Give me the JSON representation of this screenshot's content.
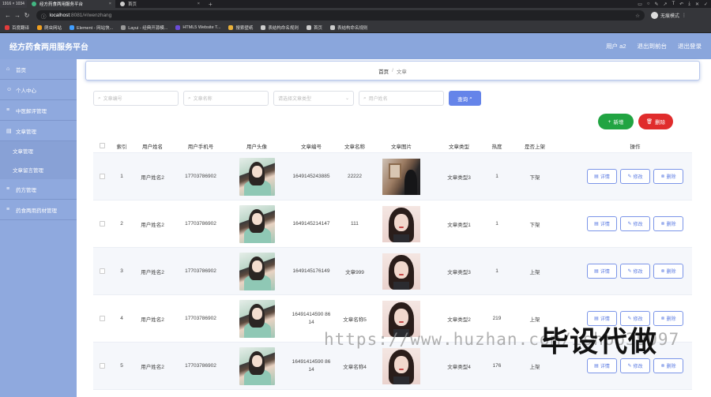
{
  "browser": {
    "resolution_badge": "1916 × 1034",
    "tabs": [
      {
        "title": "经方药食两用服务平台",
        "active": true
      },
      {
        "title": "首页",
        "active": false
      }
    ],
    "url_host": "localhost",
    "url_path": ":8081/#/wenzhang",
    "incognito_label": "无痕模式",
    "bookmarks": [
      {
        "label": "百度翻译",
        "color": "#e23c3c"
      },
      {
        "label": "爬虫网站",
        "color": "#f0a020"
      },
      {
        "label": "Element - 网站快...",
        "color": "#409eff"
      },
      {
        "label": "Layui - 经典开源模...",
        "color": "#999999"
      },
      {
        "label": "HTML5 Website T...",
        "color": "#6a4cd8"
      },
      {
        "label": "搜索壁纸",
        "color": "#e9b13a"
      },
      {
        "label": "表结构命名规则",
        "color": "#cccccc"
      },
      {
        "label": "首页",
        "color": "#cccccc"
      },
      {
        "label": "表结构命名规则",
        "color": "#cccccc"
      }
    ]
  },
  "header": {
    "title": "经方药食两用服务平台",
    "user_label": "用户 a2",
    "exit_label": "退出到前台",
    "logout_label": "退出登录"
  },
  "sidebar": {
    "items": [
      {
        "label": "首页",
        "icon": "home-icon"
      },
      {
        "label": "个人中心",
        "icon": "user-icon"
      },
      {
        "label": "中医解评管理",
        "icon": "list-icon"
      },
      {
        "label": "文章管理",
        "icon": "doc-icon"
      }
    ],
    "subitems": [
      {
        "label": "文章管理"
      },
      {
        "label": "文章留言管理"
      }
    ],
    "items_after": [
      {
        "label": "药方管理",
        "icon": "list-icon"
      },
      {
        "label": "药食两用药材管理",
        "icon": "list-icon"
      }
    ]
  },
  "breadcrumb": {
    "home": "首页",
    "separator": "/",
    "current": "文章"
  },
  "search": {
    "article_no_placeholder": "文章编号",
    "article_name_placeholder": "文章名称",
    "article_type_placeholder": "请选择文章类型",
    "user_name_placeholder": "用户姓名",
    "search_label": "查询"
  },
  "actions": {
    "add_label": "新增",
    "delete_label": "删除"
  },
  "table": {
    "headers": {
      "index": "索引",
      "user_name": "用户姓名",
      "user_phone": "用户手机号",
      "avatar": "用户头像",
      "article_no": "文章编号",
      "article_name": "文章名称",
      "article_image": "文章图片",
      "article_type": "文章类型",
      "hot": "热度",
      "on_shelf": "是否上架",
      "ops": "操作"
    },
    "op_labels": {
      "detail": "详情",
      "edit": "修改",
      "delete": "删除"
    },
    "rows": [
      {
        "index": "1",
        "user_name": "用户姓名2",
        "phone": "17703786902",
        "article_no": "1649145243885",
        "article_name": "22222",
        "image": "photo-a",
        "article_type": "文章类型3",
        "hot": "1",
        "on_shelf": "下架"
      },
      {
        "index": "2",
        "user_name": "用户姓名2",
        "phone": "17703786902",
        "article_no": "1649145214147",
        "article_name": "111",
        "image": "photo-b",
        "article_type": "文章类型1",
        "hot": "1",
        "on_shelf": "下架"
      },
      {
        "index": "3",
        "user_name": "用户姓名2",
        "phone": "17703786902",
        "article_no": "1649145176149",
        "article_name": "文章999",
        "image": "photo-b",
        "article_type": "文章类型3",
        "hot": "1",
        "on_shelf": "上架"
      },
      {
        "index": "4",
        "user_name": "用户姓名2",
        "phone": "17703786902",
        "article_no": "16491414590 8614",
        "article_name": "文章名称5",
        "image": "photo-b",
        "article_type": "文章类型2",
        "hot": "219",
        "on_shelf": "上架"
      },
      {
        "index": "5",
        "user_name": "用户姓名2",
        "phone": "17703786902",
        "article_no": "16491414590 8614",
        "article_name": "文章名称4",
        "image": "photo-b",
        "article_type": "文章类型4",
        "hot": "176",
        "on_shelf": "上架"
      }
    ]
  },
  "watermark": {
    "url": "https://www.huzhan.com/ishop39097",
    "text": "毕设代做"
  }
}
